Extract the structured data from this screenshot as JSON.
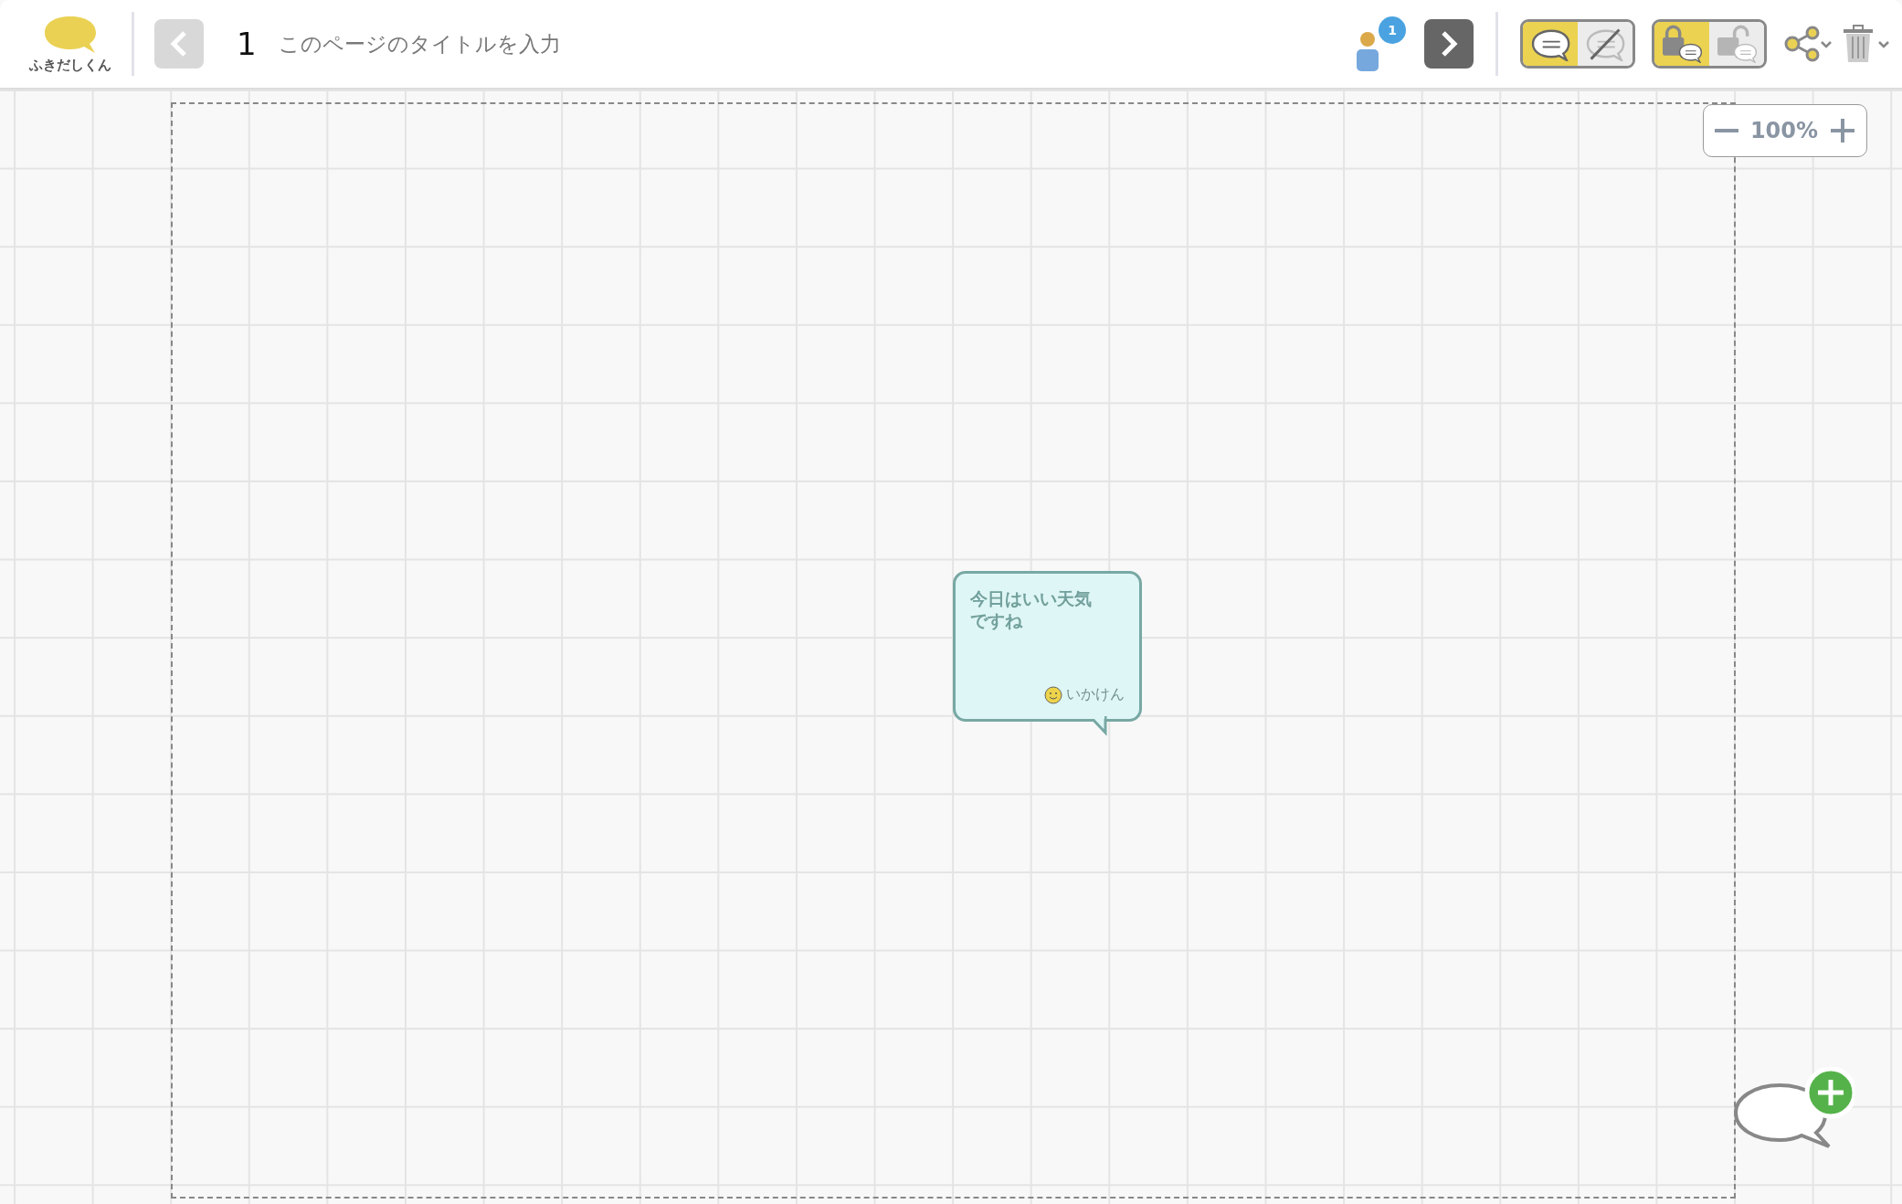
{
  "app": {
    "name": "ふきだしくん"
  },
  "nav": {
    "prev_disabled": true,
    "next_disabled": false
  },
  "page": {
    "number": "1",
    "title_placeholder": "このページのタイトルを入力"
  },
  "participants": {
    "count": "1"
  },
  "toggles": [
    {
      "kind": "visibility",
      "options": [
        {
          "selected": true
        },
        {
          "selected": false
        }
      ]
    },
    {
      "kind": "lock",
      "options": [
        {
          "selected": true
        },
        {
          "selected": false
        }
      ]
    }
  ],
  "zoom": {
    "value": "100%"
  },
  "bubbles": [
    {
      "text": "今日はいい天気ですね",
      "author": "いかけん"
    }
  ]
}
